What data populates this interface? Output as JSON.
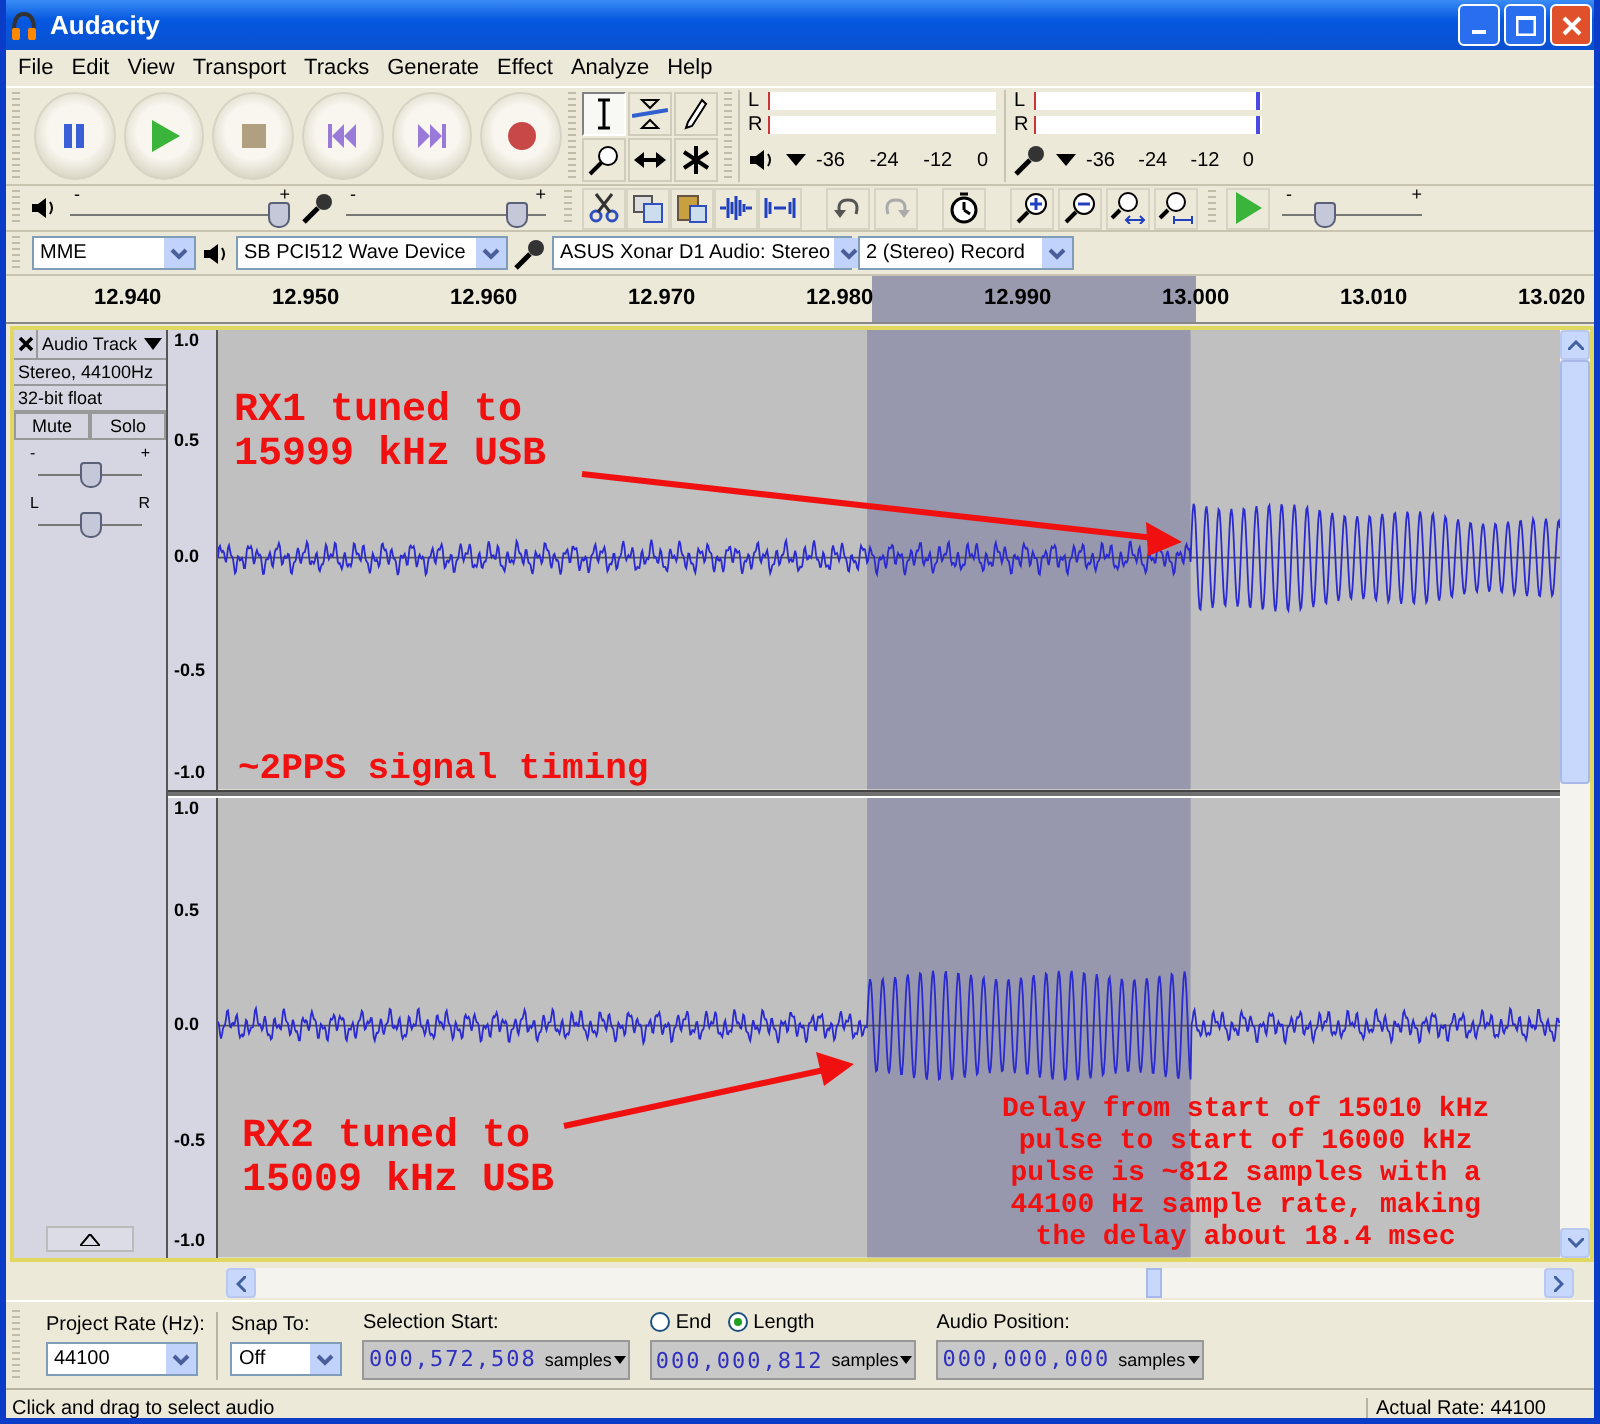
{
  "window": {
    "title": "Audacity"
  },
  "menu": [
    "File",
    "Edit",
    "View",
    "Transport",
    "Tracks",
    "Generate",
    "Effect",
    "Analyze",
    "Help"
  ],
  "meters": [
    {
      "kind": "playback",
      "channels": [
        "L",
        "R"
      ],
      "scale": [
        "-36",
        "-24",
        "-12",
        "0"
      ]
    },
    {
      "kind": "record",
      "channels": [
        "L",
        "R"
      ],
      "scale": [
        "-36",
        "-24",
        "-12",
        "0"
      ],
      "level": 0.97
    }
  ],
  "mixer": {
    "playback_volume": {
      "labels": [
        "-",
        "+"
      ],
      "level": 0.95
    },
    "record_volume": {
      "labels": [
        "-",
        "+"
      ],
      "level": 0.85
    }
  },
  "play_at_speed": {
    "labels": [
      "-",
      "+"
    ],
    "level": 0.3
  },
  "devices": {
    "host": "MME",
    "output": "SB PCI512 Wave Device",
    "input": "ASUS Xonar D1 Audio: Stereo",
    "channels": "2 (Stereo) Record"
  },
  "ruler": {
    "ticks": [
      "12.940",
      "12.950",
      "12.960",
      "12.970",
      "12.980",
      "12.990",
      "13.000",
      "13.010",
      "13.020"
    ]
  },
  "track": {
    "name": "Audio Track",
    "info": [
      "Stereo, 44100Hz",
      "32-bit float"
    ],
    "buttons": [
      {
        "label": "Mute",
        "selected": false
      },
      {
        "label": "Solo",
        "selected": false
      }
    ],
    "gain": {
      "labels": [
        "-",
        "+"
      ],
      "level": 0.5
    },
    "pan": {
      "labels": [
        "L",
        "R"
      ],
      "level": 0.5
    },
    "channels": [
      {
        "scale": [
          "1.0",
          "0.5",
          "0.0",
          "-0.5",
          "-1.0"
        ]
      },
      {
        "scale": [
          "1.0",
          "0.5",
          "0.0",
          "-0.5",
          "-1.0"
        ]
      }
    ]
  },
  "annotations": [
    {
      "kind": "large",
      "text": "RX1 tuned to\n15999 kHz USB"
    },
    {
      "kind": "title",
      "text": "~2PPS signal timing"
    },
    {
      "kind": "large",
      "text": "RX2 tuned to\n15009 kHz USB"
    },
    {
      "kind": "note",
      "text": "Delay from start of 15010 kHz\npulse to start of 16000 kHz\npulse is ~812 samples with a\n44100 Hz sample rate, making\nthe delay about 18.4 msec"
    }
  ],
  "selection_bar": {
    "project_rate": {
      "label": "Project Rate (Hz):",
      "value": "44100"
    },
    "snap_to": {
      "label": "Snap To:",
      "value": "Off"
    },
    "selection_start": {
      "label": "Selection Start:",
      "value": "000,572,508",
      "unit": "samples"
    },
    "end_length": {
      "options": [
        {
          "label": "End",
          "selected": false
        },
        {
          "label": "Length",
          "selected": true
        }
      ],
      "value": "000,000,812",
      "unit": "samples"
    },
    "audio_position": {
      "label": "Audio Position:",
      "value": "000,000,000",
      "unit": "samples"
    }
  },
  "status_bar": {
    "message": "Click and drag to select audio",
    "rate": "Actual Rate: 44100"
  }
}
